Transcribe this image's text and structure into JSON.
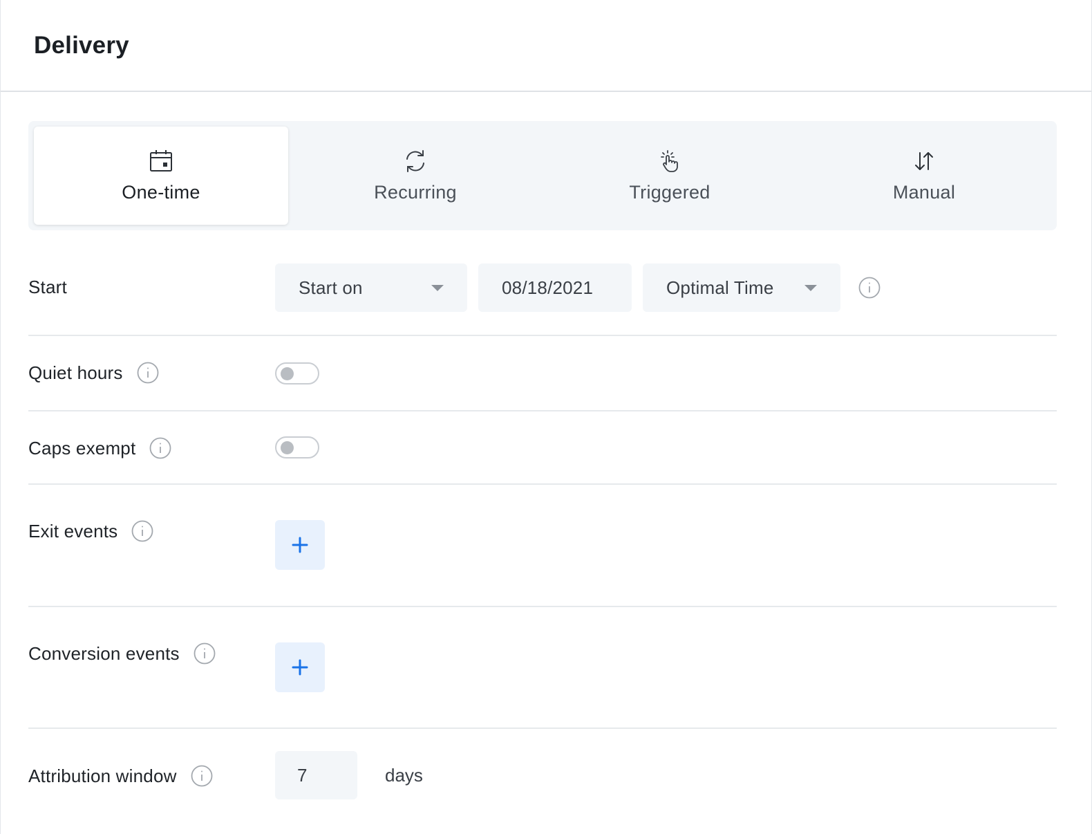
{
  "header": {
    "title": "Delivery"
  },
  "tabs": [
    {
      "label": "One-time",
      "icon": "calendar-icon",
      "active": true
    },
    {
      "label": "Recurring",
      "icon": "refresh-icon",
      "active": false
    },
    {
      "label": "Triggered",
      "icon": "pointer-click-icon",
      "active": false
    },
    {
      "label": "Manual",
      "icon": "sort-arrows-icon",
      "active": false
    }
  ],
  "start": {
    "label": "Start",
    "mode_value": "Start on",
    "date_value": "08/18/2021",
    "time_value": "Optimal Time"
  },
  "quiet_hours": {
    "label": "Quiet hours",
    "enabled": false
  },
  "caps_exempt": {
    "label": "Caps exempt",
    "enabled": false
  },
  "exit_events": {
    "label": "Exit events",
    "add_label": "+"
  },
  "conversion_events": {
    "label": "Conversion events",
    "add_label": "+"
  },
  "attribution_window": {
    "label": "Attribution window",
    "value": "7",
    "unit": "days"
  },
  "colors": {
    "accent": "#1a73e8",
    "panel_bg": "#f3f6f9",
    "add_button_bg": "#e8f1fd",
    "icon_gray": "#a3a8ae"
  }
}
